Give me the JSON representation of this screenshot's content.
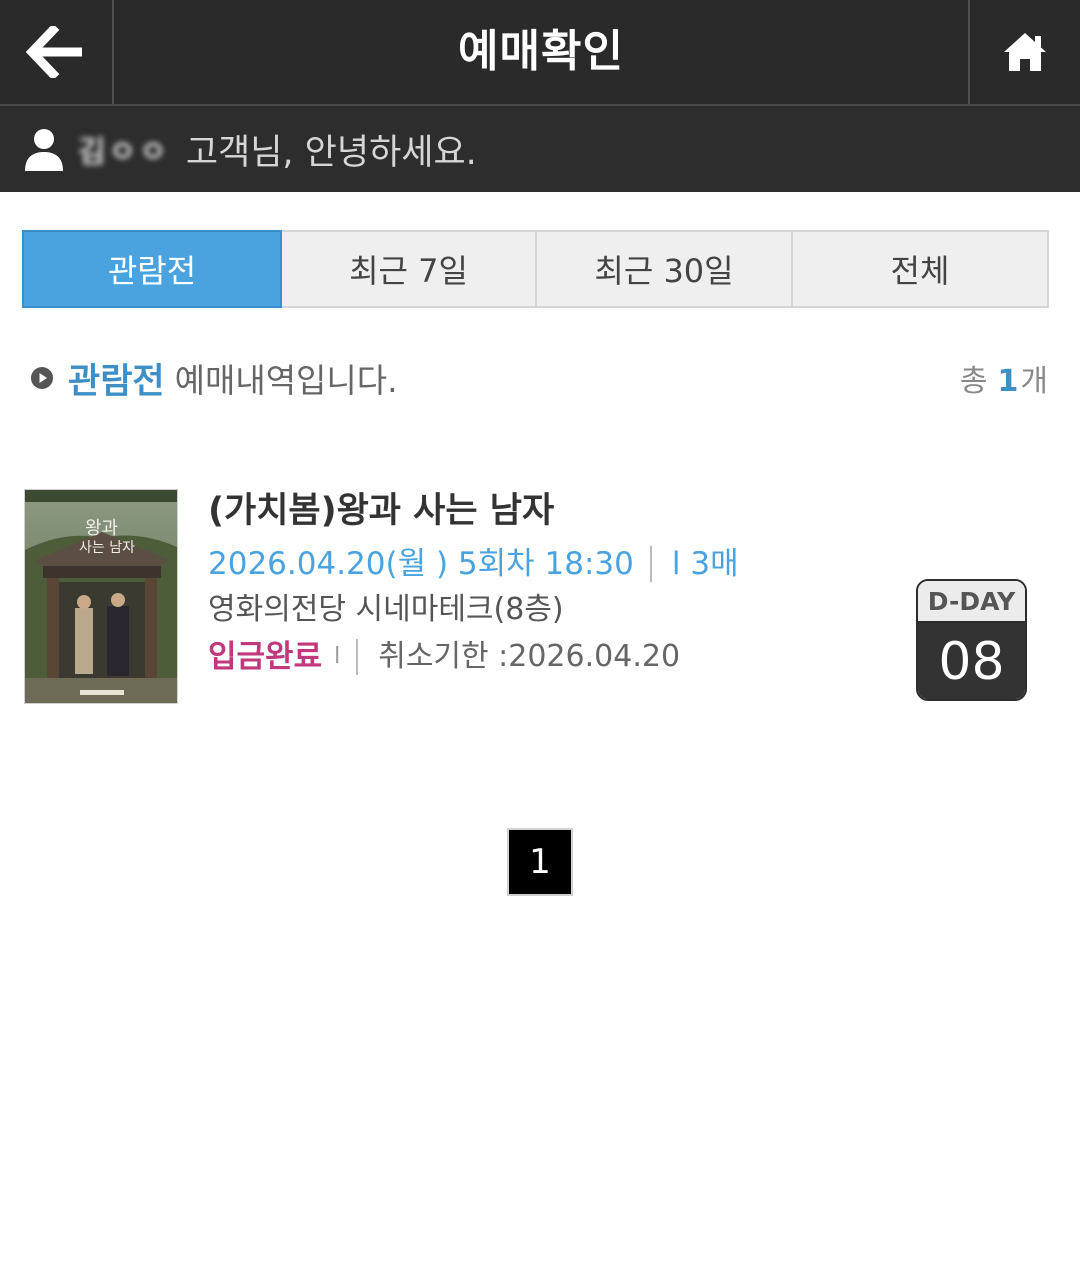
{
  "header": {
    "title": "예매확인",
    "back_icon": "arrow-left-icon",
    "home_icon": "home-icon"
  },
  "user": {
    "icon": "user-icon",
    "name": "김ㅇㅇ",
    "greeting": "고객님, 안녕하세요."
  },
  "tabs": [
    {
      "label": "관람전",
      "active": true
    },
    {
      "label": "최근 7일",
      "active": false
    },
    {
      "label": "최근 30일",
      "active": false
    },
    {
      "label": "전체",
      "active": false
    }
  ],
  "section": {
    "highlight": "관람전",
    "text": "예매내역입니다.",
    "total_prefix": "총",
    "total_count": "1",
    "total_suffix": "개"
  },
  "booking": {
    "title": "(가치봄)왕과 사는 남자",
    "datetime": "2026.04.20(월 ) 5회차 18:30",
    "tickets": "l 3매",
    "venue": "영화의전당 시네마테크(8층)",
    "payment_status": "입금완료",
    "status_mark": "l",
    "cancel_deadline": "취소기한 :2026.04.20",
    "dday_label": "D-DAY",
    "dday_value": "08"
  },
  "pagination": {
    "current": "1"
  },
  "colors": {
    "header_bg": "#2a2a2a",
    "accent_blue": "#4aa3df",
    "status_pink": "#c2387c",
    "dday_dark": "#333333"
  }
}
